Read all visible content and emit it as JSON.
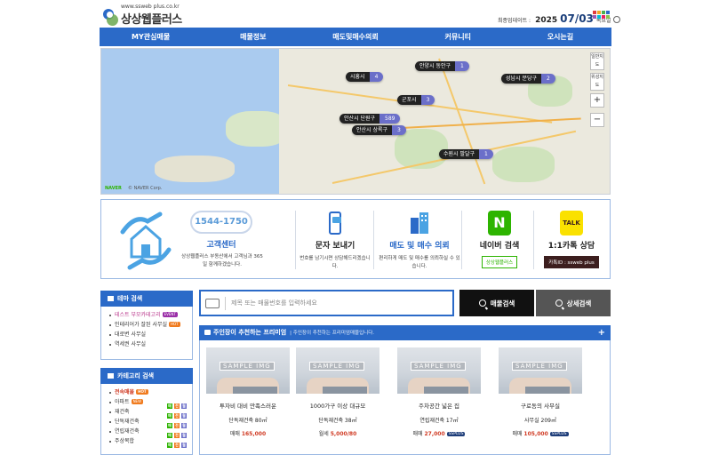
{
  "header": {
    "site_url": "www.ssweb plus.co.kr",
    "site_name": "상상웹플러스",
    "update_label": "최종업데이트 :",
    "update_year": "2025",
    "update_date": "07/03",
    "update_weekday": "목요일"
  },
  "nav": [
    "MY관심매물",
    "매물정보",
    "매도및매수의뢰",
    "커뮤니티",
    "오시는길"
  ],
  "map": {
    "markers": [
      {
        "label": "안양시 동안구",
        "count": "1"
      },
      {
        "label": "시흥시",
        "count": "4"
      },
      {
        "label": "성남시 분당구",
        "count": "2"
      },
      {
        "label": "군포시",
        "count": "3"
      },
      {
        "label": "안산시 단원구",
        "count": "589"
      },
      {
        "label": "안산시 상록구",
        "count": "3"
      },
      {
        "label": "수원시 팔달구",
        "count": "1"
      }
    ],
    "controls": [
      "일반지도",
      "위성지도",
      "+",
      "−"
    ],
    "naver_logo": "NAVER",
    "copyright": "© NAVER Corp."
  },
  "services": {
    "phone": "1544-1750",
    "center_title": "고객센터",
    "center_desc": "상상웹플러스 부동산에서 고객님과 365일 함께하겠습니다.",
    "sms": {
      "title": "문자 보내기",
      "desc": "번호를 남기시면 상담해드리겠습니다."
    },
    "request": {
      "title": "매도 및 매수 의뢰",
      "desc": "편리하게 매도 및 매수를 의뢰하실 수 있습니다."
    },
    "naver": {
      "title": "네이버 검색",
      "button": "상상웹플러스"
    },
    "kakao": {
      "title": "1:1카톡 상담",
      "button": "카톡ID : ssweb plus"
    }
  },
  "theme": {
    "header": "테마 검색",
    "items": [
      {
        "label": "테스트 부모카테고리",
        "badge": "EVENT"
      },
      {
        "label": "인테리어가 잘된 사무실",
        "badge": "HOT"
      },
      {
        "label": "대로변 사무실",
        "badge": ""
      },
      {
        "label": "역세권 사무실",
        "badge": ""
      }
    ]
  },
  "category": {
    "header": "카테고리 검색",
    "items": [
      {
        "label": "전속매물",
        "badge": "HOT"
      },
      {
        "label": "아파트",
        "badge": "NEW"
      },
      {
        "label": "재건축",
        "badge": ""
      },
      {
        "label": "단독재건축",
        "badge": ""
      },
      {
        "label": "연립재건축",
        "badge": ""
      },
      {
        "label": "주상복합",
        "badge": ""
      }
    ]
  },
  "search": {
    "placeholder": "제목 또는 매물번호를 입력하세요",
    "btn_search": "매물검색",
    "btn_detail": "상세검색"
  },
  "premium": {
    "title": "주인장이 추천하는 프리미엄",
    "subtitle": "| 주인장이 추천하는 프리미엄매물입니다.",
    "plus": "+",
    "cards": [
      {
        "title": "투자비 대비 만족스러운",
        "spec": "단독재건축 80㎡",
        "price_label": "매매",
        "price": "165,000",
        "level": ""
      },
      {
        "title": "1000가구 이상 대규모",
        "spec": "단독재건축 38㎡",
        "price_label": "월세",
        "price": "5,000/80",
        "level": ""
      },
      {
        "title": "주차공간 넓은 집",
        "spec": "연립재건축 17㎡",
        "price_label": "매매",
        "price": "27,000",
        "level": "SSPLUS"
      },
      {
        "title": "구로동의 사무실",
        "spec": "사무실 209㎡",
        "price_label": "매매",
        "price": "105,000",
        "level": "SSPLUS"
      }
    ],
    "sample_img": "SAMPLE IMG"
  },
  "colors": {
    "accent": "#2b6ac8",
    "price": "#d03b24",
    "marker": "#6b6fc9"
  }
}
